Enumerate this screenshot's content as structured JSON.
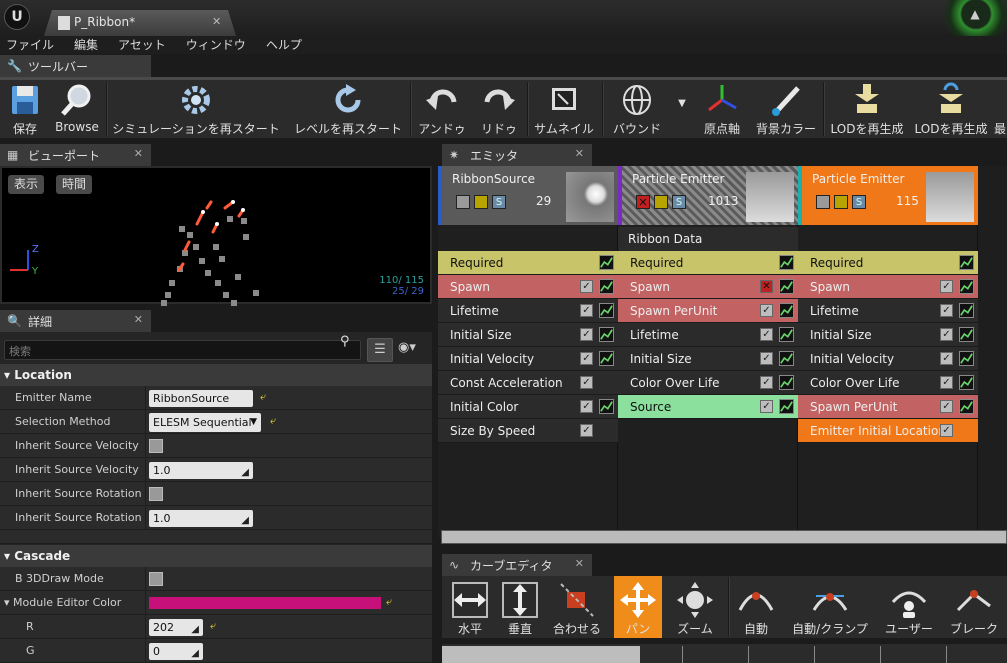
{
  "window": {
    "doc_tab": "P_Ribbon*",
    "close_glyph": "✕",
    "logo": "U"
  },
  "menu": [
    "ファイル",
    "編集",
    "アセット",
    "ウィンドウ",
    "ヘルプ"
  ],
  "toolbar": {
    "tab_label": "ツールバー",
    "buttons": [
      {
        "label": "保存",
        "icon": "save-icon"
      },
      {
        "label": "Browse",
        "icon": "browse-magnifier-icon"
      },
      {
        "label": "シミュレーションを再スタート",
        "icon": "gear-restart-icon"
      },
      {
        "label": "レベルを再スタート",
        "icon": "restart-level-icon"
      },
      {
        "label": "アンドゥ",
        "icon": "undo-icon"
      },
      {
        "label": "リドゥ",
        "icon": "redo-icon"
      },
      {
        "label": "サムネイル",
        "icon": "thumbnail-icon"
      },
      {
        "label": "バウンド",
        "icon": "bounds-icon"
      },
      {
        "label": "原点軸",
        "icon": "origin-axis-icon"
      },
      {
        "label": "背景カラー",
        "icon": "background-color-icon"
      },
      {
        "label": "LODを再生成",
        "icon": "regen-lod-icon"
      },
      {
        "label": "LODを再生成",
        "icon": "regen-lod-icon"
      },
      {
        "label": "最",
        "icon": "lod-icon"
      }
    ]
  },
  "viewport": {
    "tab_label": "ビューポート",
    "buttons": [
      "表示",
      "時間"
    ],
    "stats_line1": "110/ 115",
    "stats_line2": "25/  29",
    "axis_z": "Z",
    "axis_y": "Y"
  },
  "details": {
    "tab_label": "詳細",
    "search_placeholder": "検索",
    "categories": [
      {
        "name": "Location",
        "rows": [
          {
            "label": "Emitter Name",
            "type": "text",
            "value": "RibbonSource"
          },
          {
            "label": "Selection Method",
            "type": "dropdown",
            "value": "ELESM Sequential"
          },
          {
            "label": "Inherit Source Velocity",
            "type": "checkbox"
          },
          {
            "label": "Inherit Source Velocity Sc",
            "type": "number",
            "value": "1.0"
          },
          {
            "label": "Inherit Source Rotation",
            "type": "checkbox"
          },
          {
            "label": "Inherit Source Rotation Sc",
            "type": "number",
            "value": "1.0"
          }
        ]
      },
      {
        "name": "Cascade",
        "rows": [
          {
            "label": "B 3DDraw Mode",
            "type": "checkbox"
          },
          {
            "label": "Module Editor Color",
            "type": "color",
            "value": "#c8107a"
          },
          {
            "label": "R",
            "type": "number",
            "value": "202"
          },
          {
            "label": "G",
            "type": "number",
            "value": "0"
          }
        ]
      }
    ]
  },
  "emitters": {
    "tab_label": "エミッタ",
    "columns": [
      {
        "name": "RibbonSource",
        "count": "29",
        "accent": "#2a5cc8",
        "header_bg": "#5a5a5a",
        "type_label": "",
        "modules": [
          {
            "label": "Required",
            "style": "req",
            "check": false,
            "graph": true
          },
          {
            "label": "Spawn",
            "style": "spawn",
            "check": true,
            "graph": true
          },
          {
            "label": "Lifetime",
            "style": "normal",
            "check": true,
            "graph": true
          },
          {
            "label": "Initial Size",
            "style": "normal",
            "check": true,
            "graph": true
          },
          {
            "label": "Initial Velocity",
            "style": "normal",
            "check": true,
            "graph": true
          },
          {
            "label": "Const Acceleration",
            "style": "normal",
            "check": true,
            "graph": false
          },
          {
            "label": "Initial Color",
            "style": "normal",
            "check": true,
            "graph": true
          },
          {
            "label": "Size By Speed",
            "style": "normal",
            "check": true,
            "graph": false
          }
        ]
      },
      {
        "name": "Particle Emitter",
        "count": "1013",
        "accent": "#7a2ac8",
        "header_bg": "#6a6a6a",
        "type_label": "Ribbon Data",
        "modules": [
          {
            "label": "Required",
            "style": "req",
            "check": false,
            "graph": true
          },
          {
            "label": "Spawn",
            "style": "spawn",
            "check": "x",
            "graph": true
          },
          {
            "label": "Spawn PerUnit",
            "style": "spawn",
            "check": true,
            "graph": true
          },
          {
            "label": "Lifetime",
            "style": "normal",
            "check": true,
            "graph": true
          },
          {
            "label": "Initial Size",
            "style": "normal",
            "check": true,
            "graph": true
          },
          {
            "label": "Color Over Life",
            "style": "normal",
            "check": true,
            "graph": true
          },
          {
            "label": "Source",
            "style": "source",
            "check": true,
            "graph": true
          }
        ]
      },
      {
        "name": "Particle Emitter",
        "count": "115",
        "accent": "#1ab0b0",
        "header_bg": "#f07818",
        "type_label": "",
        "modules": [
          {
            "label": "Required",
            "style": "req",
            "check": false,
            "graph": true
          },
          {
            "label": "Spawn",
            "style": "spawn",
            "check": true,
            "graph": true
          },
          {
            "label": "Lifetime",
            "style": "normal",
            "check": true,
            "graph": true
          },
          {
            "label": "Initial Size",
            "style": "normal",
            "check": true,
            "graph": true
          },
          {
            "label": "Initial Velocity",
            "style": "normal",
            "check": true,
            "graph": true
          },
          {
            "label": "Color Over Life",
            "style": "normal",
            "check": true,
            "graph": true
          },
          {
            "label": "Spawn PerUnit",
            "style": "spawn",
            "check": true,
            "graph": true
          },
          {
            "label": "Emitter Initial Location",
            "style": "orange",
            "check": true,
            "graph": false
          }
        ]
      }
    ]
  },
  "curve_editor": {
    "tab_label": "カーブエディタ",
    "tools": [
      {
        "label": "水平",
        "icon": "fit-horizontal-icon",
        "active": false
      },
      {
        "label": "垂直",
        "icon": "fit-vertical-icon",
        "active": false
      },
      {
        "label": "合わせる",
        "icon": "fit-icon",
        "active": false
      },
      {
        "label": "パン",
        "icon": "pan-icon",
        "active": true
      },
      {
        "label": "ズーム",
        "icon": "zoom-icon",
        "active": false
      },
      {
        "label": "自動",
        "icon": "auto-tangent-icon",
        "active": false
      },
      {
        "label": "自動/クランプ",
        "icon": "auto-clamp-tangent-icon",
        "active": false
      },
      {
        "label": "ユーザー",
        "icon": "user-tangent-icon",
        "active": false
      },
      {
        "label": "ブレーク",
        "icon": "break-tangent-icon",
        "active": false
      }
    ]
  }
}
